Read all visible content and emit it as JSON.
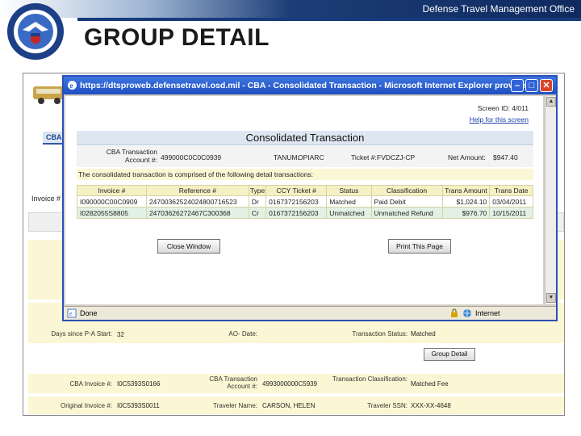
{
  "slide": {
    "org_title": "Defense Travel Management Office",
    "title": "GROUP DETAIL"
  },
  "background_page": {
    "tab": "CBA",
    "invoice_label": "Invoice #",
    "days_label": "Days since P-A Start:",
    "days_value": "32",
    "ao_date_label": "AO- Date:",
    "status_label": "Transaction Status:",
    "status_value": "Matched",
    "group_detail_button": "Group Detail",
    "cba_invoice_label": "CBA Invoice #:",
    "cba_invoice_value": "I0C5393S0166",
    "cba_account_label": "CBA Transaction Account #:",
    "cba_account_value": "4993000000C5939",
    "classification_label": "Transaction Classification:",
    "classification_value": "Matched Fee",
    "original_invoice_label": "Original Invoice #:",
    "original_invoice_value": "I0C5393S0011",
    "traveler_name_label": "Traveler Name:",
    "traveler_name_value": "CARSON, HELEN",
    "traveler_ssn_label": "Traveler SSN:",
    "traveler_ssn_value": "XXX-XX-4648"
  },
  "popup": {
    "title": "https://dtsproweb.defensetravel.osd.mil - CBA - Consolidated Transaction - Microsoft Internet Explorer provide...",
    "screen_id": "Screen ID: 4/011",
    "help_link": "Help for this screen",
    "heading": "Consolidated Transaction",
    "info": {
      "account_label": "CBA Transaction Account #:",
      "account_value": "499000C0C0C0939",
      "tanum_label": "TANUM:",
      "tanum_value": "OPIARC",
      "ticket_label": "Ticket #:",
      "ticket_value": "FVDCZJ-CP",
      "net_label": "Net Amount:",
      "net_value": "$947.40"
    },
    "description": "The consolidated transaction is comprised of the following detail transactions:",
    "columns": [
      "Invoice #",
      "Reference #",
      "Type",
      "CCY Ticket #",
      "Status",
      "Classification",
      "Trans Amount",
      "Trans Date"
    ],
    "rows": [
      [
        "I090000C00C0909",
        "24700362524024800716523",
        "Dr",
        "0167372156203",
        "Matched",
        "Paid Debit",
        "$1,024.10",
        "03/04/2011"
      ],
      [
        "I0282055S8805",
        "24703626272467C300368",
        "Cr",
        "0167372156203",
        "Unmatched",
        "Unmatched Refund",
        "$976.70",
        "10/15/2011"
      ]
    ],
    "close_button": "Close Window",
    "print_button": "Print This Page",
    "status_done": "Done",
    "status_zone": "Internet"
  }
}
